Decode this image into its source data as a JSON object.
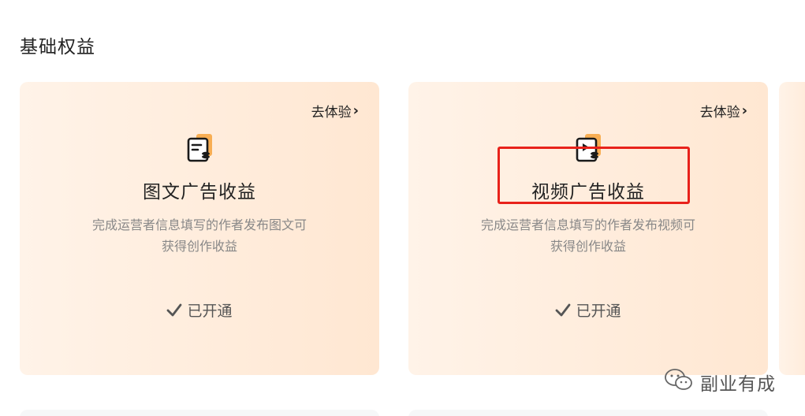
{
  "section": {
    "title": "基础权益"
  },
  "cards": [
    {
      "try_label": "去体验",
      "icon": "article-doc-icon",
      "title": "图文广告收益",
      "desc_line1": "完成运营者信息填写的作者发布图文可",
      "desc_line2": "获得创作收益",
      "status": "已开通"
    },
    {
      "try_label": "去体验",
      "icon": "video-doc-icon",
      "title": "视频广告收益",
      "desc_line1": "完成运营者信息填写的作者发布视频可",
      "desc_line2": "获得创作收益",
      "status": "已开通"
    }
  ],
  "watermark": {
    "text": "副业有成",
    "icon": "wechat-icon"
  },
  "colors": {
    "accent_orange": "#f7a23b",
    "highlight_red": "#e8221b"
  }
}
